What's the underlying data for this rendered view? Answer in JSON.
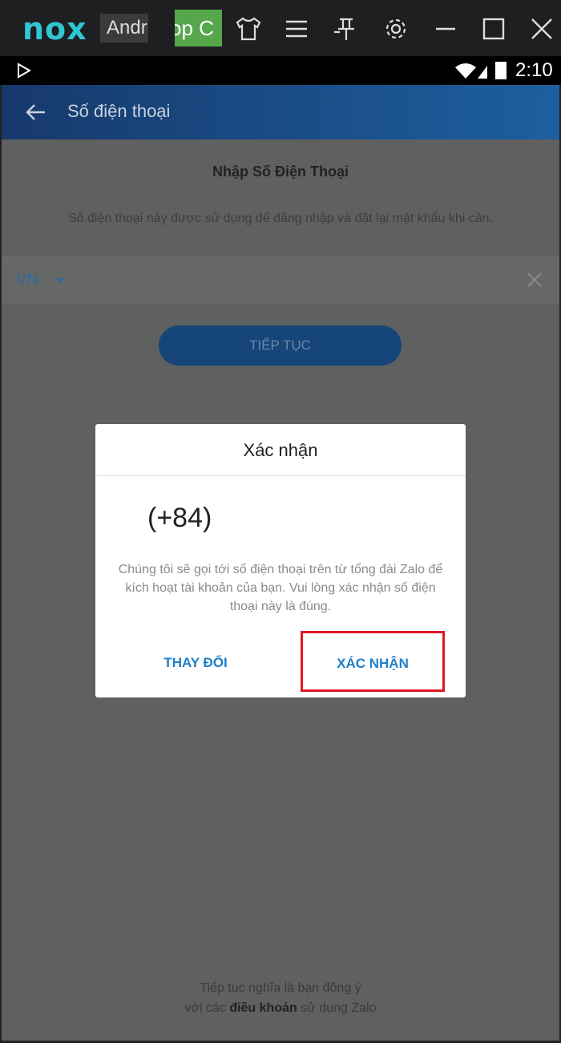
{
  "emulator": {
    "logo": "nox",
    "tabs": [
      {
        "label": "Andr"
      },
      {
        "label": "op C"
      }
    ],
    "icons": [
      "shirt-icon",
      "menu-icon",
      "pin-icon",
      "gear-icon",
      "minimize-icon",
      "maximize-icon",
      "close-icon"
    ]
  },
  "status_bar": {
    "time": "2:10"
  },
  "app_bar": {
    "title": "Số điện thoại"
  },
  "content": {
    "section_title": "Nhập Số Điện Thoại",
    "description": "Số điện thoại này được sử dụng để đăng nhập và đặt lại mật khẩu khi cần.",
    "country_code": "VN",
    "phone_value": "",
    "continue_label": "TIẾP TỤC",
    "terms_line1": "Tiếp tục nghĩa là bạn đồng ý",
    "terms_prefix": "với các ",
    "terms_link": "điều khoản",
    "terms_suffix": " sử dụng Zalo"
  },
  "dialog": {
    "title": "Xác nhận",
    "number": "(+84)",
    "message": "Chúng tôi sẽ gọi tới số điện thoại trên từ tổng đài Zalo để kích hoạt tài khoản của bạn. Vui lòng xác nhận số điện thoại này là đúng.",
    "change_label": "THAY ĐỔI",
    "confirm_label": "XÁC NHẬN"
  },
  "colors": {
    "accent": "#1e7fc8",
    "highlight": "#e01822",
    "app_bar": "#1d5fa0"
  }
}
